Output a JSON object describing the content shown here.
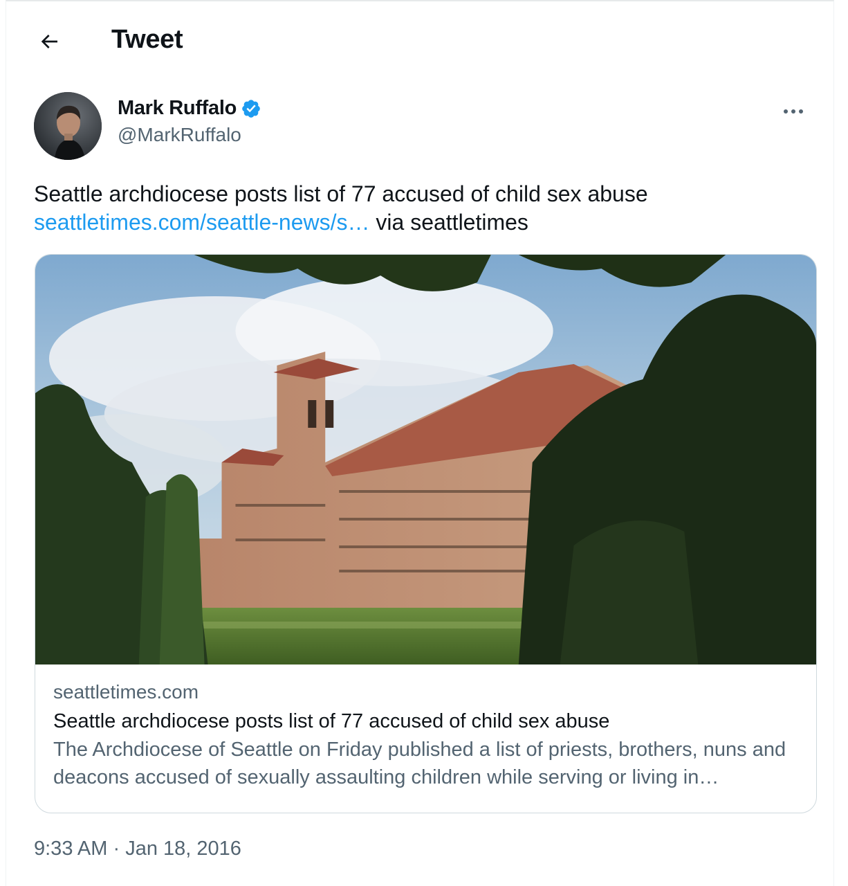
{
  "header": {
    "title": "Tweet"
  },
  "author": {
    "display_name": "Mark Ruffalo",
    "handle": "@MarkRuffalo",
    "verified": true
  },
  "tweet": {
    "text_line1": "Seattle archdiocese posts list of 77 accused of child sex abuse",
    "link_text": "seattletimes.com/seattle-news/s…",
    "via_text": " via seattletimes"
  },
  "card": {
    "domain": "seattletimes.com",
    "title": "Seattle archdiocese posts list of 77 accused of child sex abuse",
    "description": "The Archdiocese of Seattle on Friday published a list of priests, brothers, nuns and deacons accused of sexually assaulting children while serving or living in…"
  },
  "meta": {
    "time": "9:33 AM",
    "separator": " · ",
    "date": "Jan 18, 2016"
  },
  "icons": {
    "back": "arrow-left-icon",
    "verified": "verified-badge-icon",
    "more": "more-options-icon"
  },
  "colors": {
    "link": "#1d9bf0",
    "secondary_text": "#536471",
    "verified": "#1d9bf0"
  }
}
